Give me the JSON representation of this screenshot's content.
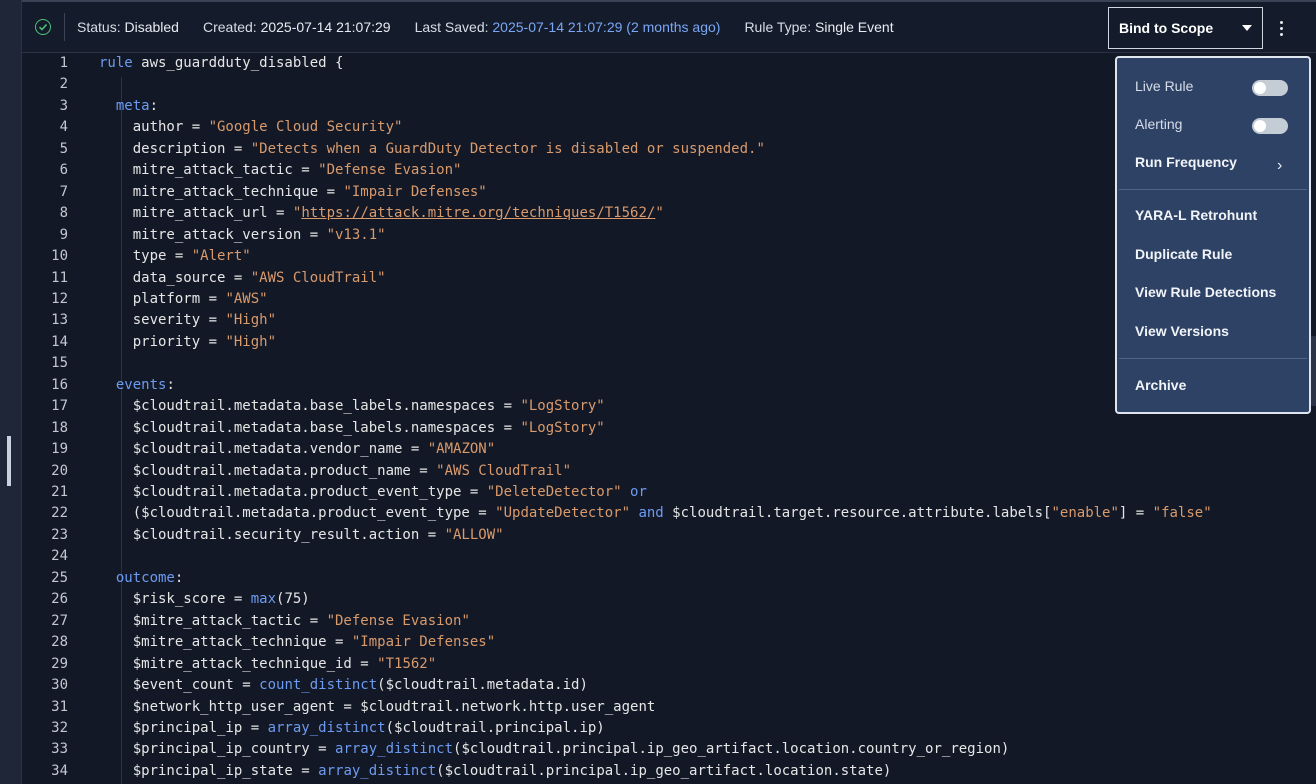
{
  "status_bar": {
    "status_label": "Status:",
    "status_value": "Disabled",
    "created_label": "Created:",
    "created_value": "2025-07-14 21:07:29",
    "saved_label": "Last Saved:",
    "saved_value": "2025-07-14 21:07:29 (2 months ago)",
    "type_label": "Rule Type:",
    "type_value": "Single Event",
    "bind_button": "Bind to Scope"
  },
  "menu": {
    "live_rule": "Live Rule",
    "live_rule_on": false,
    "alerting": "Alerting",
    "alerting_on": false,
    "run_frequency": "Run Frequency",
    "yara_retrohunt": "YARA-L Retrohunt",
    "duplicate_rule": "Duplicate Rule",
    "view_detections": "View Rule Detections",
    "view_versions": "View Versions",
    "archive": "Archive"
  },
  "icons": {
    "status": "check-circle-icon",
    "dropdown": "caret-down-icon",
    "more": "kebab-icon",
    "submenu": "chevron-right-icon",
    "side_panel": "chevron-left-icon"
  },
  "colors": {
    "accent_green": "#4fc27b",
    "keyword": "#6d9bf0",
    "string": "#d99a6c",
    "menu_bg": "#2e4266"
  },
  "code_lines": [
    {
      "n": "1",
      "s": [
        [
          "kw",
          "rule"
        ],
        [
          "t",
          " aws_guardduty_disabled {"
        ]
      ]
    },
    {
      "n": "2",
      "s": []
    },
    {
      "n": "3",
      "s": [
        [
          "t",
          "  "
        ],
        [
          "kw",
          "meta"
        ],
        [
          "t",
          ":"
        ]
      ]
    },
    {
      "n": "4",
      "s": [
        [
          "t",
          "    author = "
        ],
        [
          "str",
          "\"Google Cloud Security\""
        ]
      ]
    },
    {
      "n": "5",
      "s": [
        [
          "t",
          "    description = "
        ],
        [
          "str",
          "\"Detects when a GuardDuty Detector is disabled or suspended.\""
        ]
      ]
    },
    {
      "n": "6",
      "s": [
        [
          "t",
          "    mitre_attack_tactic = "
        ],
        [
          "str",
          "\"Defense Evasion\""
        ]
      ]
    },
    {
      "n": "7",
      "s": [
        [
          "t",
          "    mitre_attack_technique = "
        ],
        [
          "str",
          "\"Impair Defenses\""
        ]
      ]
    },
    {
      "n": "8",
      "s": [
        [
          "t",
          "    mitre_attack_url = "
        ],
        [
          "str",
          "\""
        ],
        [
          "url",
          "https://attack.mitre.org/techniques/T1562/"
        ],
        [
          "str",
          "\""
        ]
      ]
    },
    {
      "n": "9",
      "s": [
        [
          "t",
          "    mitre_attack_version = "
        ],
        [
          "str",
          "\"v13.1\""
        ]
      ]
    },
    {
      "n": "10",
      "s": [
        [
          "t",
          "    type = "
        ],
        [
          "str",
          "\"Alert\""
        ]
      ]
    },
    {
      "n": "11",
      "s": [
        [
          "t",
          "    data_source = "
        ],
        [
          "str",
          "\"AWS CloudTrail\""
        ]
      ]
    },
    {
      "n": "12",
      "s": [
        [
          "t",
          "    platform = "
        ],
        [
          "str",
          "\"AWS\""
        ]
      ]
    },
    {
      "n": "13",
      "s": [
        [
          "t",
          "    severity = "
        ],
        [
          "str",
          "\"High\""
        ]
      ]
    },
    {
      "n": "14",
      "s": [
        [
          "t",
          "    priority = "
        ],
        [
          "str",
          "\"High\""
        ]
      ]
    },
    {
      "n": "15",
      "s": []
    },
    {
      "n": "16",
      "s": [
        [
          "t",
          "  "
        ],
        [
          "kw",
          "events"
        ],
        [
          "t",
          ":"
        ]
      ]
    },
    {
      "n": "17",
      "s": [
        [
          "t",
          "    $cloudtrail.metadata.base_labels.namespaces = "
        ],
        [
          "str",
          "\"LogStory\""
        ]
      ]
    },
    {
      "n": "18",
      "s": [
        [
          "t",
          "    $cloudtrail.metadata.base_labels.namespaces = "
        ],
        [
          "str",
          "\"LogStory\""
        ]
      ]
    },
    {
      "n": "19",
      "s": [
        [
          "t",
          "    $cloudtrail.metadata.vendor_name = "
        ],
        [
          "str",
          "\"AMAZON\""
        ]
      ]
    },
    {
      "n": "20",
      "s": [
        [
          "t",
          "    $cloudtrail.metadata.product_name = "
        ],
        [
          "str",
          "\"AWS CloudTrail\""
        ]
      ]
    },
    {
      "n": "21",
      "s": [
        [
          "t",
          "    $cloudtrail.metadata.product_event_type = "
        ],
        [
          "str",
          "\"DeleteDetector\""
        ],
        [
          "t",
          " "
        ],
        [
          "kw",
          "or"
        ]
      ]
    },
    {
      "n": "22",
      "s": [
        [
          "t",
          "    ($cloudtrail.metadata.product_event_type = "
        ],
        [
          "str",
          "\"UpdateDetector\""
        ],
        [
          "t",
          " "
        ],
        [
          "kw",
          "and"
        ],
        [
          "t",
          " $cloudtrail.target.resource.attribute.labels["
        ],
        [
          "str",
          "\"enable\""
        ],
        [
          "t",
          "] = "
        ],
        [
          "str",
          "\"false\""
        ]
      ]
    },
    {
      "n": "23",
      "s": [
        [
          "t",
          "    $cloudtrail.security_result.action = "
        ],
        [
          "str",
          "\"ALLOW\""
        ]
      ]
    },
    {
      "n": "24",
      "s": []
    },
    {
      "n": "25",
      "s": [
        [
          "t",
          "  "
        ],
        [
          "kw",
          "outcome"
        ],
        [
          "t",
          ":"
        ]
      ]
    },
    {
      "n": "26",
      "s": [
        [
          "t",
          "    $risk_score = "
        ],
        [
          "fn",
          "max"
        ],
        [
          "t",
          "(75)"
        ]
      ]
    },
    {
      "n": "27",
      "s": [
        [
          "t",
          "    $mitre_attack_tactic = "
        ],
        [
          "str",
          "\"Defense Evasion\""
        ]
      ]
    },
    {
      "n": "28",
      "s": [
        [
          "t",
          "    $mitre_attack_technique = "
        ],
        [
          "str",
          "\"Impair Defenses\""
        ]
      ]
    },
    {
      "n": "29",
      "s": [
        [
          "t",
          "    $mitre_attack_technique_id = "
        ],
        [
          "str",
          "\"T1562\""
        ]
      ]
    },
    {
      "n": "30",
      "s": [
        [
          "t",
          "    $event_count = "
        ],
        [
          "fn",
          "count_distinct"
        ],
        [
          "t",
          "($cloudtrail.metadata.id)"
        ]
      ]
    },
    {
      "n": "31",
      "s": [
        [
          "t",
          "    $network_http_user_agent = $cloudtrail.network.http.user_agent"
        ]
      ]
    },
    {
      "n": "32",
      "s": [
        [
          "t",
          "    $principal_ip = "
        ],
        [
          "fn",
          "array_distinct"
        ],
        [
          "t",
          "($cloudtrail.principal.ip)"
        ]
      ]
    },
    {
      "n": "33",
      "s": [
        [
          "t",
          "    $principal_ip_country = "
        ],
        [
          "fn",
          "array_distinct"
        ],
        [
          "t",
          "($cloudtrail.principal.ip_geo_artifact.location.country_or_region)"
        ]
      ]
    },
    {
      "n": "34",
      "s": [
        [
          "t",
          "    $principal_ip_state = "
        ],
        [
          "fn",
          "array_distinct"
        ],
        [
          "t",
          "($cloudtrail.principal.ip_geo_artifact.location.state)"
        ]
      ]
    }
  ]
}
